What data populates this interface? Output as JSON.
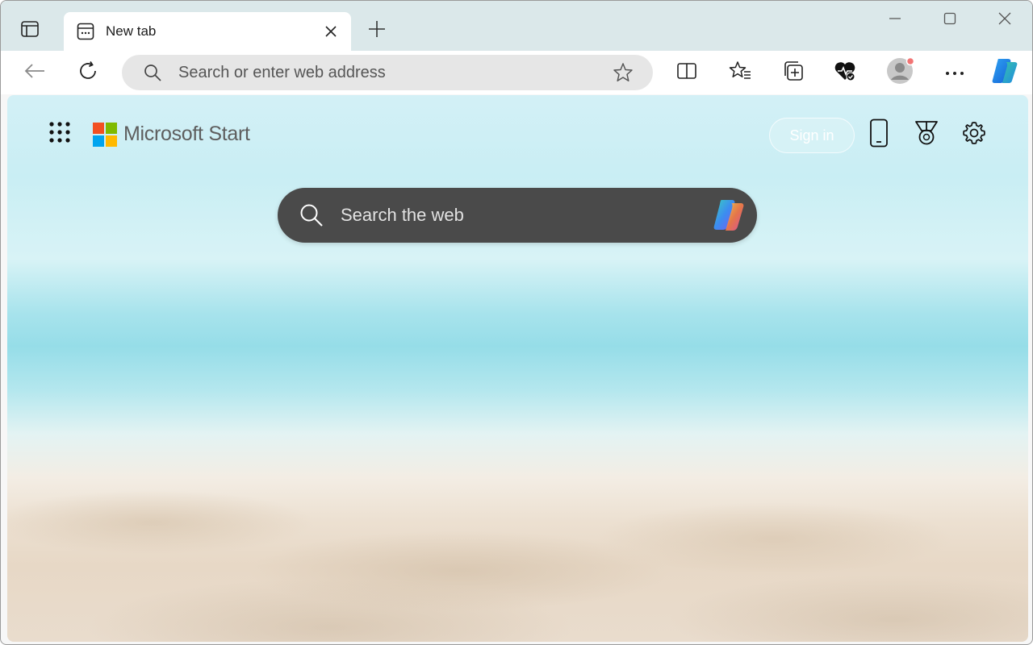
{
  "browser": {
    "tab": {
      "title": "New tab"
    },
    "addressbar": {
      "placeholder": "Search or enter web address"
    },
    "toolbar_icons": [
      "back-icon",
      "refresh-icon",
      "split-screen-icon",
      "favorites-icon",
      "collections-icon",
      "browser-essentials-icon",
      "profile-icon",
      "more-icon",
      "copilot-icon"
    ],
    "window_controls": [
      "minimize-icon",
      "maximize-icon",
      "close-icon"
    ]
  },
  "newtab": {
    "brand": "Microsoft Start",
    "signin_label": "Sign in",
    "search": {
      "placeholder": "Search the web"
    },
    "header_icons": [
      "phone-icon",
      "rewards-medal-icon",
      "settings-gear-icon"
    ]
  },
  "colors": {
    "tabstrip": "#dbe8ea",
    "searchbox": "#4a4a4a",
    "logo_red": "#f25022",
    "logo_green": "#7fba00",
    "logo_blue": "#00a4ef",
    "logo_yellow": "#ffb900",
    "profile_badge": "#f27474"
  }
}
